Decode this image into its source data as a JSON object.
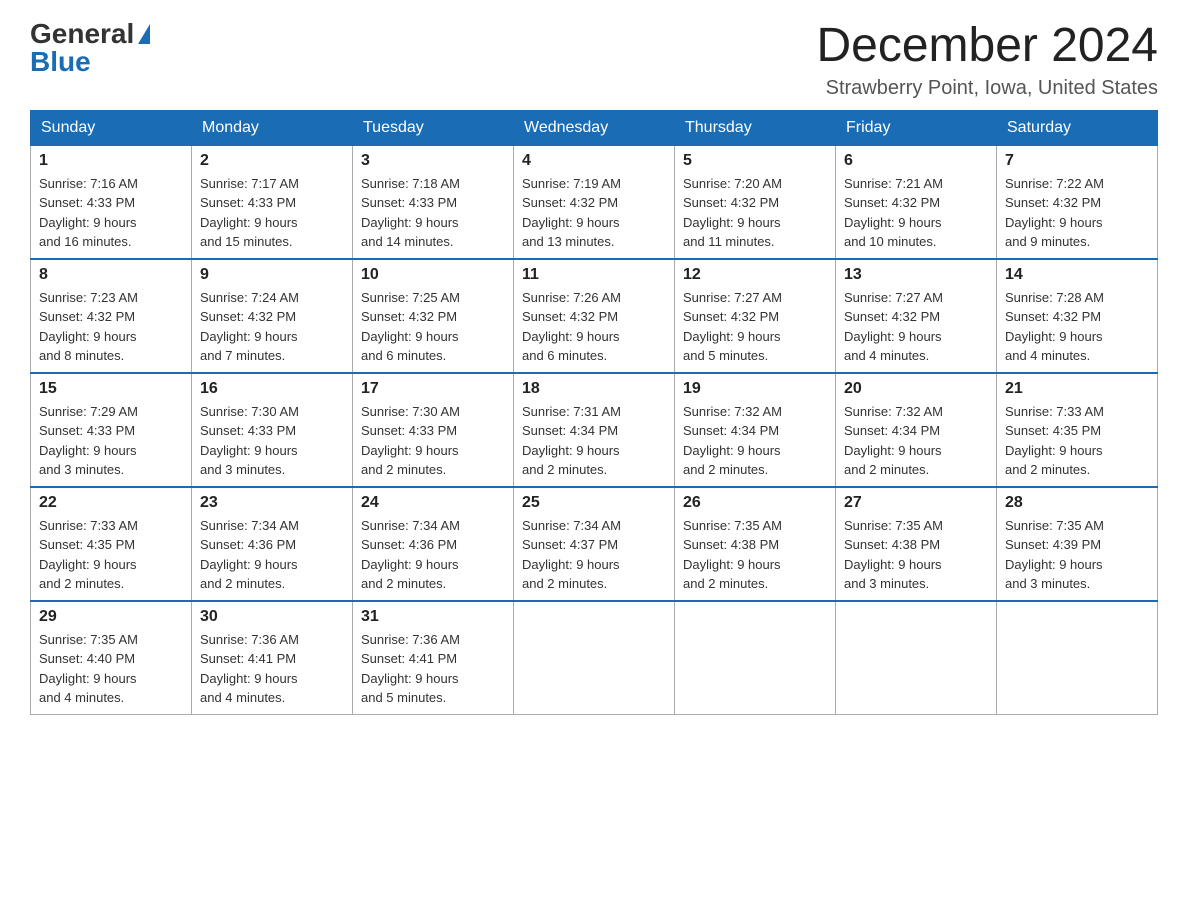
{
  "logo": {
    "general": "General",
    "blue": "Blue"
  },
  "title": "December 2024",
  "location": "Strawberry Point, Iowa, United States",
  "weekdays": [
    "Sunday",
    "Monday",
    "Tuesday",
    "Wednesday",
    "Thursday",
    "Friday",
    "Saturday"
  ],
  "weeks": [
    [
      {
        "day": "1",
        "sunrise": "7:16 AM",
        "sunset": "4:33 PM",
        "daylight": "9 hours and 16 minutes."
      },
      {
        "day": "2",
        "sunrise": "7:17 AM",
        "sunset": "4:33 PM",
        "daylight": "9 hours and 15 minutes."
      },
      {
        "day": "3",
        "sunrise": "7:18 AM",
        "sunset": "4:33 PM",
        "daylight": "9 hours and 14 minutes."
      },
      {
        "day": "4",
        "sunrise": "7:19 AM",
        "sunset": "4:32 PM",
        "daylight": "9 hours and 13 minutes."
      },
      {
        "day": "5",
        "sunrise": "7:20 AM",
        "sunset": "4:32 PM",
        "daylight": "9 hours and 11 minutes."
      },
      {
        "day": "6",
        "sunrise": "7:21 AM",
        "sunset": "4:32 PM",
        "daylight": "9 hours and 10 minutes."
      },
      {
        "day": "7",
        "sunrise": "7:22 AM",
        "sunset": "4:32 PM",
        "daylight": "9 hours and 9 minutes."
      }
    ],
    [
      {
        "day": "8",
        "sunrise": "7:23 AM",
        "sunset": "4:32 PM",
        "daylight": "9 hours and 8 minutes."
      },
      {
        "day": "9",
        "sunrise": "7:24 AM",
        "sunset": "4:32 PM",
        "daylight": "9 hours and 7 minutes."
      },
      {
        "day": "10",
        "sunrise": "7:25 AM",
        "sunset": "4:32 PM",
        "daylight": "9 hours and 6 minutes."
      },
      {
        "day": "11",
        "sunrise": "7:26 AM",
        "sunset": "4:32 PM",
        "daylight": "9 hours and 6 minutes."
      },
      {
        "day": "12",
        "sunrise": "7:27 AM",
        "sunset": "4:32 PM",
        "daylight": "9 hours and 5 minutes."
      },
      {
        "day": "13",
        "sunrise": "7:27 AM",
        "sunset": "4:32 PM",
        "daylight": "9 hours and 4 minutes."
      },
      {
        "day": "14",
        "sunrise": "7:28 AM",
        "sunset": "4:32 PM",
        "daylight": "9 hours and 4 minutes."
      }
    ],
    [
      {
        "day": "15",
        "sunrise": "7:29 AM",
        "sunset": "4:33 PM",
        "daylight": "9 hours and 3 minutes."
      },
      {
        "day": "16",
        "sunrise": "7:30 AM",
        "sunset": "4:33 PM",
        "daylight": "9 hours and 3 minutes."
      },
      {
        "day": "17",
        "sunrise": "7:30 AM",
        "sunset": "4:33 PM",
        "daylight": "9 hours and 2 minutes."
      },
      {
        "day": "18",
        "sunrise": "7:31 AM",
        "sunset": "4:34 PM",
        "daylight": "9 hours and 2 minutes."
      },
      {
        "day": "19",
        "sunrise": "7:32 AM",
        "sunset": "4:34 PM",
        "daylight": "9 hours and 2 minutes."
      },
      {
        "day": "20",
        "sunrise": "7:32 AM",
        "sunset": "4:34 PM",
        "daylight": "9 hours and 2 minutes."
      },
      {
        "day": "21",
        "sunrise": "7:33 AM",
        "sunset": "4:35 PM",
        "daylight": "9 hours and 2 minutes."
      }
    ],
    [
      {
        "day": "22",
        "sunrise": "7:33 AM",
        "sunset": "4:35 PM",
        "daylight": "9 hours and 2 minutes."
      },
      {
        "day": "23",
        "sunrise": "7:34 AM",
        "sunset": "4:36 PM",
        "daylight": "9 hours and 2 minutes."
      },
      {
        "day": "24",
        "sunrise": "7:34 AM",
        "sunset": "4:36 PM",
        "daylight": "9 hours and 2 minutes."
      },
      {
        "day": "25",
        "sunrise": "7:34 AM",
        "sunset": "4:37 PM",
        "daylight": "9 hours and 2 minutes."
      },
      {
        "day": "26",
        "sunrise": "7:35 AM",
        "sunset": "4:38 PM",
        "daylight": "9 hours and 2 minutes."
      },
      {
        "day": "27",
        "sunrise": "7:35 AM",
        "sunset": "4:38 PM",
        "daylight": "9 hours and 3 minutes."
      },
      {
        "day": "28",
        "sunrise": "7:35 AM",
        "sunset": "4:39 PM",
        "daylight": "9 hours and 3 minutes."
      }
    ],
    [
      {
        "day": "29",
        "sunrise": "7:35 AM",
        "sunset": "4:40 PM",
        "daylight": "9 hours and 4 minutes."
      },
      {
        "day": "30",
        "sunrise": "7:36 AM",
        "sunset": "4:41 PM",
        "daylight": "9 hours and 4 minutes."
      },
      {
        "day": "31",
        "sunrise": "7:36 AM",
        "sunset": "4:41 PM",
        "daylight": "9 hours and 5 minutes."
      },
      null,
      null,
      null,
      null
    ]
  ]
}
